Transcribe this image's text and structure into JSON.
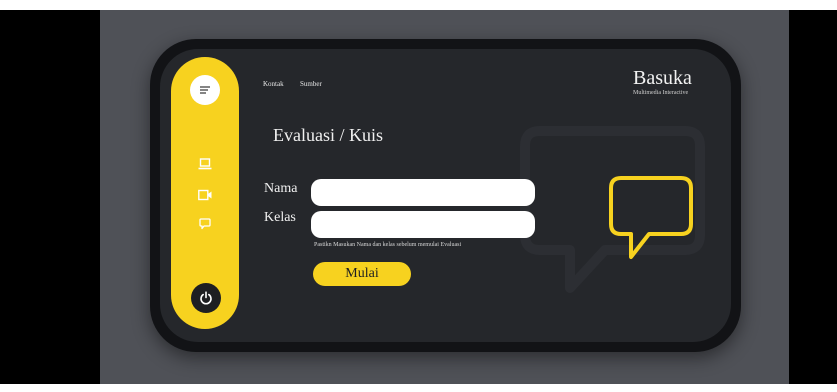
{
  "icons": {
    "menu": "menu-icon",
    "laptop": "laptop-icon",
    "video": "video-icon",
    "chat": "chat-icon",
    "power": "power-icon",
    "speech_bubble": "speech-bubble-icon"
  },
  "colors": {
    "accent": "#f7d21f",
    "screen": "#25272b",
    "frame": "#121316",
    "backdrop": "#4f5157"
  },
  "header": {
    "nav": [
      "Kontak",
      "Sumber"
    ],
    "brand_name": "Basuka",
    "brand_sub": "Multimedia Interactive"
  },
  "main": {
    "title": "Evaluasi / Kuis",
    "name_label": "Nama",
    "name_value": "",
    "class_label": "Kelas",
    "class_value": "",
    "hint": "Pastikn Masukan Nama dan kelas sebelum memulai Evaluasi",
    "start_label": "Mulai"
  }
}
